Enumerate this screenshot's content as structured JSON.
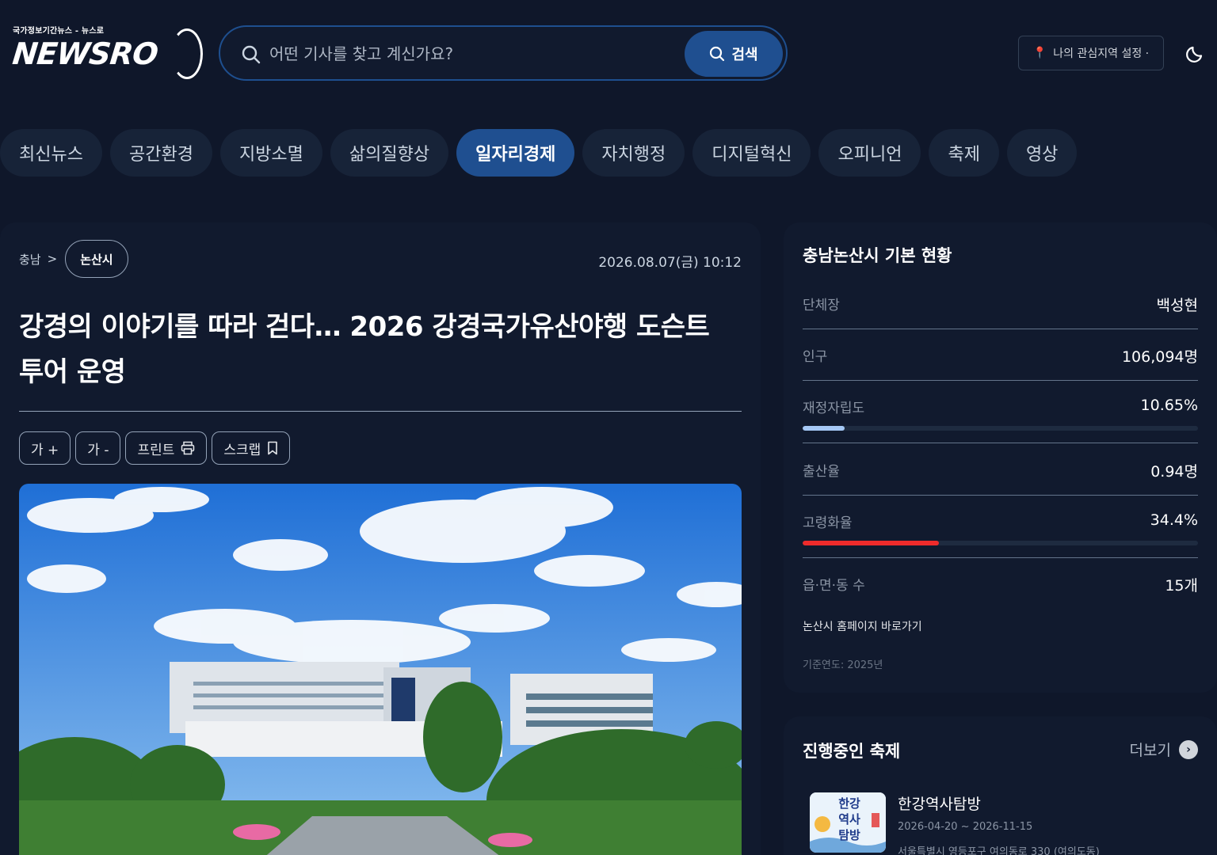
{
  "header": {
    "logo_sub": "국가정보기간뉴스 - 뉴스로",
    "logo_main": "NEWSRO",
    "search_placeholder": "어떤 기사를 찾고 계신가요?",
    "search_button": "검색",
    "region_button": "나의 관심지역 설정 ·"
  },
  "nav": {
    "tabs": [
      {
        "label": "최신뉴스",
        "active": false
      },
      {
        "label": "공간환경",
        "active": false
      },
      {
        "label": "지방소멸",
        "active": false
      },
      {
        "label": "삶의질향상",
        "active": false
      },
      {
        "label": "일자리경제",
        "active": true
      },
      {
        "label": "자치행정",
        "active": false
      },
      {
        "label": "디지털혁신",
        "active": false
      },
      {
        "label": "오피니언",
        "active": false
      },
      {
        "label": "축제",
        "active": false
      },
      {
        "label": "영상",
        "active": false
      }
    ]
  },
  "article": {
    "breadcrumb_parent": "충남",
    "breadcrumb_sep": ">",
    "breadcrumb_current": "논산시",
    "date": "2026.08.07(금) 10:12",
    "title": "강경의 이야기를 따라 걷다… 2026 강경국가유산야행 도슨트 투어 운영",
    "tools": {
      "font_up": "가 +",
      "font_down": "가 -",
      "print": "프린트",
      "scrap": "스크랩"
    }
  },
  "stats": {
    "title": "충남논산시 기본 현황",
    "rows": [
      {
        "label": "단체장",
        "value": "백성현"
      },
      {
        "label": "인구",
        "value": "106,094명"
      },
      {
        "label": "재정자립도",
        "value": "10.65%",
        "bar_fraction": 0.1065,
        "bar_color": "#a5c8f5"
      },
      {
        "label": "출산율",
        "value": "0.94명"
      },
      {
        "label": "고령화율",
        "value": "34.4%",
        "bar_fraction": 0.344,
        "bar_color": "#ef2b2b"
      },
      {
        "label": "읍·면·동 수",
        "value": "15개"
      }
    ],
    "homepage_link": "논산시 홈페이지 바로가기",
    "base_year": "기준연도: 2025년"
  },
  "festival": {
    "title": "진행중인 축제",
    "more": "더보기",
    "more_icon": "chevron-right-icon",
    "items": [
      {
        "thumb_text": "한강 역사 탐방",
        "name": "한강역사탐방",
        "date": "2026-04-20 ~ 2026-11-15",
        "address": "서울특별시 영등포구 여의동로 330 (여의도동)"
      }
    ]
  },
  "colors": {
    "background": "#0f172a",
    "card": "#111a2e",
    "accent": "#1f4f90",
    "pin": "#ef4444"
  }
}
